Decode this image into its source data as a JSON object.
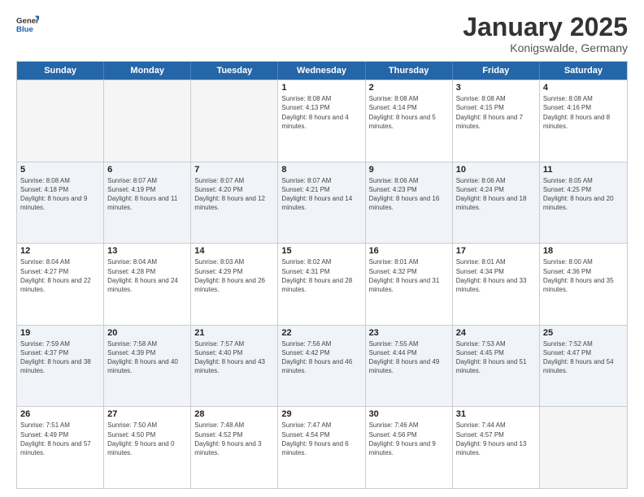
{
  "logo": {
    "general": "General",
    "blue": "Blue"
  },
  "header": {
    "month": "January 2025",
    "location": "Konigswalde, Germany"
  },
  "weekdays": [
    "Sunday",
    "Monday",
    "Tuesday",
    "Wednesday",
    "Thursday",
    "Friday",
    "Saturday"
  ],
  "rows": [
    {
      "cells": [
        {
          "day": "",
          "empty": true
        },
        {
          "day": "",
          "empty": true
        },
        {
          "day": "",
          "empty": true
        },
        {
          "day": "1",
          "sunrise": "8:08 AM",
          "sunset": "4:13 PM",
          "daylight": "8 hours and 4 minutes."
        },
        {
          "day": "2",
          "sunrise": "8:08 AM",
          "sunset": "4:14 PM",
          "daylight": "8 hours and 5 minutes."
        },
        {
          "day": "3",
          "sunrise": "8:08 AM",
          "sunset": "4:15 PM",
          "daylight": "8 hours and 7 minutes."
        },
        {
          "day": "4",
          "sunrise": "8:08 AM",
          "sunset": "4:16 PM",
          "daylight": "8 hours and 8 minutes."
        }
      ]
    },
    {
      "cells": [
        {
          "day": "5",
          "sunrise": "8:08 AM",
          "sunset": "4:18 PM",
          "daylight": "8 hours and 9 minutes."
        },
        {
          "day": "6",
          "sunrise": "8:07 AM",
          "sunset": "4:19 PM",
          "daylight": "8 hours and 11 minutes."
        },
        {
          "day": "7",
          "sunrise": "8:07 AM",
          "sunset": "4:20 PM",
          "daylight": "8 hours and 12 minutes."
        },
        {
          "day": "8",
          "sunrise": "8:07 AM",
          "sunset": "4:21 PM",
          "daylight": "8 hours and 14 minutes."
        },
        {
          "day": "9",
          "sunrise": "8:06 AM",
          "sunset": "4:23 PM",
          "daylight": "8 hours and 16 minutes."
        },
        {
          "day": "10",
          "sunrise": "8:06 AM",
          "sunset": "4:24 PM",
          "daylight": "8 hours and 18 minutes."
        },
        {
          "day": "11",
          "sunrise": "8:05 AM",
          "sunset": "4:25 PM",
          "daylight": "8 hours and 20 minutes."
        }
      ]
    },
    {
      "cells": [
        {
          "day": "12",
          "sunrise": "8:04 AM",
          "sunset": "4:27 PM",
          "daylight": "8 hours and 22 minutes."
        },
        {
          "day": "13",
          "sunrise": "8:04 AM",
          "sunset": "4:28 PM",
          "daylight": "8 hours and 24 minutes."
        },
        {
          "day": "14",
          "sunrise": "8:03 AM",
          "sunset": "4:29 PM",
          "daylight": "8 hours and 26 minutes."
        },
        {
          "day": "15",
          "sunrise": "8:02 AM",
          "sunset": "4:31 PM",
          "daylight": "8 hours and 28 minutes."
        },
        {
          "day": "16",
          "sunrise": "8:01 AM",
          "sunset": "4:32 PM",
          "daylight": "8 hours and 31 minutes."
        },
        {
          "day": "17",
          "sunrise": "8:01 AM",
          "sunset": "4:34 PM",
          "daylight": "8 hours and 33 minutes."
        },
        {
          "day": "18",
          "sunrise": "8:00 AM",
          "sunset": "4:36 PM",
          "daylight": "8 hours and 35 minutes."
        }
      ]
    },
    {
      "cells": [
        {
          "day": "19",
          "sunrise": "7:59 AM",
          "sunset": "4:37 PM",
          "daylight": "8 hours and 38 minutes."
        },
        {
          "day": "20",
          "sunrise": "7:58 AM",
          "sunset": "4:39 PM",
          "daylight": "8 hours and 40 minutes."
        },
        {
          "day": "21",
          "sunrise": "7:57 AM",
          "sunset": "4:40 PM",
          "daylight": "8 hours and 43 minutes."
        },
        {
          "day": "22",
          "sunrise": "7:56 AM",
          "sunset": "4:42 PM",
          "daylight": "8 hours and 46 minutes."
        },
        {
          "day": "23",
          "sunrise": "7:55 AM",
          "sunset": "4:44 PM",
          "daylight": "8 hours and 49 minutes."
        },
        {
          "day": "24",
          "sunrise": "7:53 AM",
          "sunset": "4:45 PM",
          "daylight": "8 hours and 51 minutes."
        },
        {
          "day": "25",
          "sunrise": "7:52 AM",
          "sunset": "4:47 PM",
          "daylight": "8 hours and 54 minutes."
        }
      ]
    },
    {
      "cells": [
        {
          "day": "26",
          "sunrise": "7:51 AM",
          "sunset": "4:49 PM",
          "daylight": "8 hours and 57 minutes."
        },
        {
          "day": "27",
          "sunrise": "7:50 AM",
          "sunset": "4:50 PM",
          "daylight": "9 hours and 0 minutes."
        },
        {
          "day": "28",
          "sunrise": "7:48 AM",
          "sunset": "4:52 PM",
          "daylight": "9 hours and 3 minutes."
        },
        {
          "day": "29",
          "sunrise": "7:47 AM",
          "sunset": "4:54 PM",
          "daylight": "9 hours and 6 minutes."
        },
        {
          "day": "30",
          "sunrise": "7:46 AM",
          "sunset": "4:56 PM",
          "daylight": "9 hours and 9 minutes."
        },
        {
          "day": "31",
          "sunrise": "7:44 AM",
          "sunset": "4:57 PM",
          "daylight": "9 hours and 13 minutes."
        },
        {
          "day": "",
          "empty": true
        }
      ]
    }
  ],
  "labels": {
    "sunrise": "Sunrise:",
    "sunset": "Sunset:",
    "daylight": "Daylight:"
  }
}
